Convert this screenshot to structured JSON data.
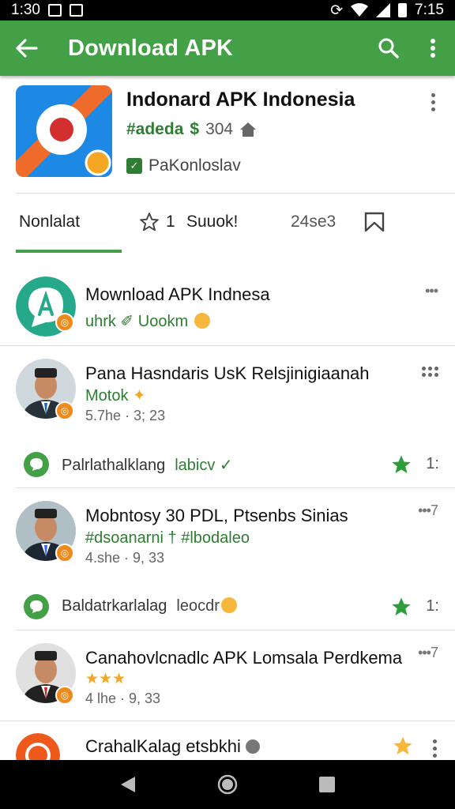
{
  "status": {
    "time": "1:30",
    "right_time": "7:15"
  },
  "appbar": {
    "title": "Download APK"
  },
  "app": {
    "name": "Indonard APK Indonesia",
    "developer": "#adeda",
    "count": "304",
    "badge": "PaKonloslav"
  },
  "tabs": [
    {
      "label": "Nonlalat"
    },
    {
      "label": "1"
    },
    {
      "label": "Suuok!"
    },
    {
      "label": "24se3"
    }
  ],
  "feed": [
    {
      "title": "Mownload APK Indnesa",
      "sub": "uhrk",
      "sub2": "Uookm"
    },
    {
      "title": "Pana Hasndaris UsK Relsjinigiaanah",
      "sub": "Motok",
      "meta": "5.7he · 3; 23"
    },
    {
      "title": "Mobntosy 30 PDL, Ptsenbs Sinias",
      "sub": "#dsoanarni † #lbodaleo",
      "meta": "4.she · 9, 33",
      "dots": "•••7"
    },
    {
      "title": "Canahovlcnadlc APK Lomsala Perdkema",
      "meta": "4 lhe · 9, 33",
      "dots": "•••7"
    },
    {
      "title": "CrahalKalag etsbkhi"
    }
  ],
  "bars": [
    {
      "label": "Palrlathalklang",
      "accent": "labicv",
      "num": "1:"
    },
    {
      "label": "Baldatrkarlalag",
      "accent": "leocdr",
      "num": "1:"
    }
  ],
  "colors": {
    "primary": "#43a047",
    "accent_text": "#2e7d32",
    "star": "#f5b83d"
  }
}
